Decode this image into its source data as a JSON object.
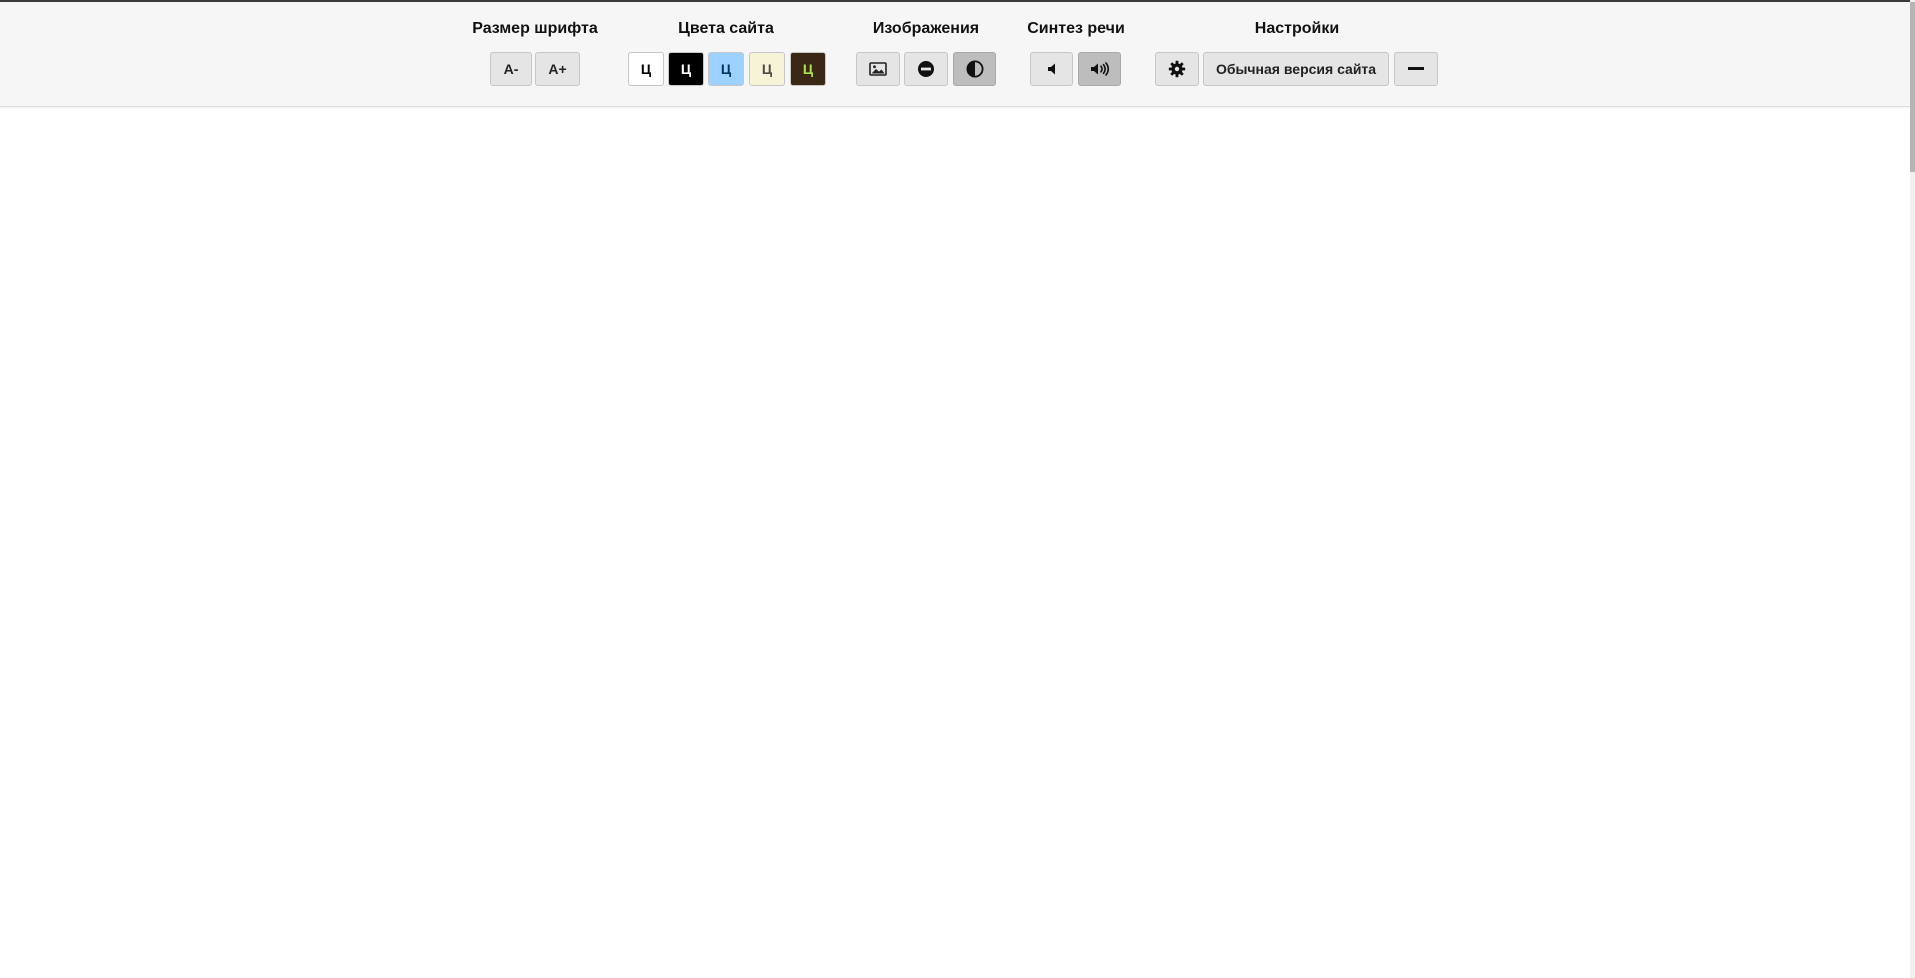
{
  "font_size": {
    "title": "Размер шрифта",
    "decrease_label": "A-",
    "increase_label": "A+"
  },
  "site_colors": {
    "title": "Цвета сайта",
    "schemes": [
      {
        "label": "Ц",
        "bg": "#ffffff",
        "fg": "#000000"
      },
      {
        "label": "Ц",
        "bg": "#000000",
        "fg": "#ffffff"
      },
      {
        "label": "Ц",
        "bg": "#9dd1ff",
        "fg": "#063462"
      },
      {
        "label": "Ц",
        "bg": "#f7f3d6",
        "fg": "#4d4b43"
      },
      {
        "label": "Ц",
        "bg": "#3b2716",
        "fg": "#a9e44d"
      }
    ]
  },
  "images": {
    "title": "Изображения",
    "buttons": [
      "image-icon",
      "no-images-icon",
      "contrast-icon"
    ]
  },
  "speech": {
    "title": "Синтез речи",
    "buttons": [
      "volume-off-icon",
      "volume-on-icon"
    ]
  },
  "settings": {
    "title": "Настройки",
    "normal_version_label": "Обычная версия сайта"
  }
}
